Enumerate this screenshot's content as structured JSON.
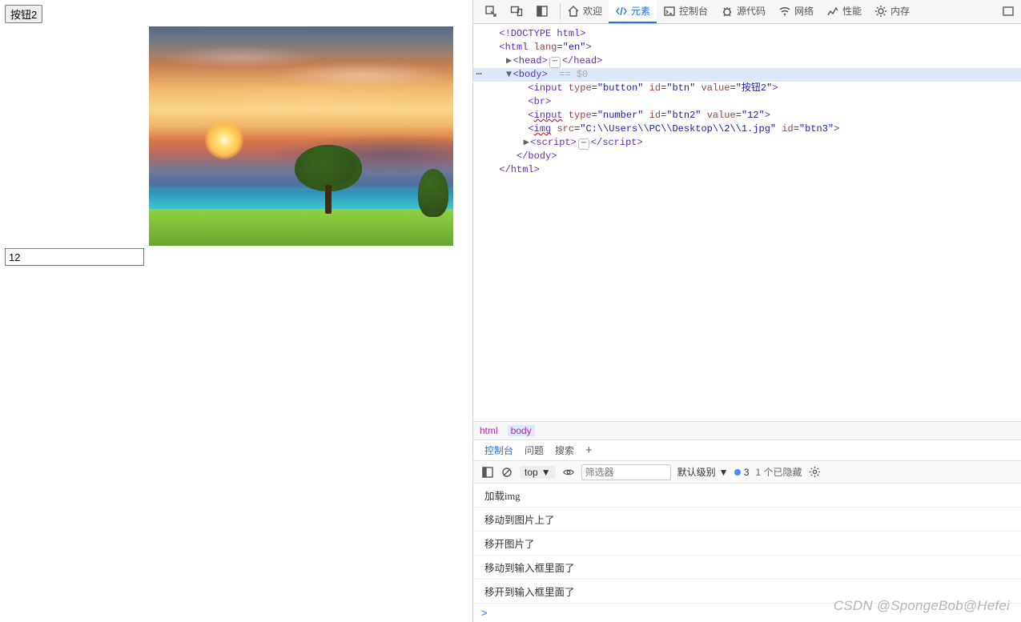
{
  "page": {
    "button2_label": "按钮2",
    "number_value": "12"
  },
  "devtools": {
    "tabs": {
      "welcome": "欢迎",
      "elements": "元素",
      "console": "控制台",
      "sources": "源代码",
      "network": "网络",
      "performance": "性能",
      "memory": "内存"
    },
    "dom": {
      "doctype": "<!DOCTYPE html>",
      "html_open": "<html lang=\"en\">",
      "head_open": "<head>",
      "head_close": "</head>",
      "body_open": "<body>",
      "body_marker": "== $0",
      "input_btn": "<input type=\"button\" id=\"btn\" value=\"按钮2\">",
      "br": "<br>",
      "input_num": {
        "tag": "input",
        "type": "number",
        "id": "btn2",
        "value": "12"
      },
      "img": {
        "tag": "img",
        "src": "C:\\\\Users\\\\PC\\\\Desktop\\\\2\\\\1.jpg",
        "id": "btn3"
      },
      "script_open": "<script>",
      "script_close": "</script>",
      "body_close": "</body>",
      "html_close": "</html>"
    },
    "breadcrumbs": [
      "html",
      "body"
    ],
    "drawer": {
      "tabs": {
        "console": "控制台",
        "issues": "问题",
        "search": "搜索"
      },
      "toolbar": {
        "context": "top",
        "filter_placeholder": "筛选器",
        "default_levels": "默认级别",
        "msg_count": "3",
        "hidden_text": "1 个已隐藏"
      },
      "logs": [
        "加载img",
        "移动到图片上了",
        "移开图片了",
        "移动到输入框里面了",
        "移开到输入框里面了"
      ],
      "prompt": ">"
    }
  },
  "watermark": "CSDN @SpongeBob@Hefei"
}
